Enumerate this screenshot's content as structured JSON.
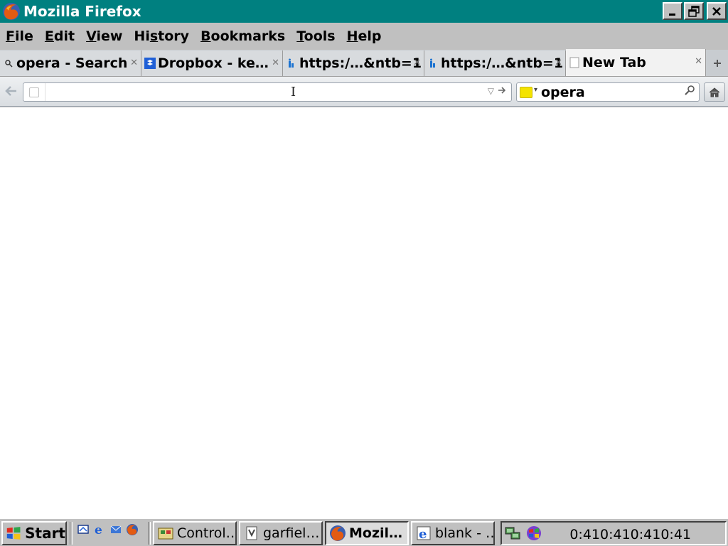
{
  "window": {
    "title": "Mozilla Firefox",
    "controls": {
      "minimize": "minimize-icon",
      "restore": "restore-icon",
      "close": "close-icon"
    }
  },
  "menu": {
    "items": [
      {
        "label": "File",
        "accel": "F",
        "rest": "ile"
      },
      {
        "label": "Edit",
        "accel": "E",
        "rest": "dit"
      },
      {
        "label": "View",
        "accel": "V",
        "rest": "iew"
      },
      {
        "label": "History",
        "pre": "Hi",
        "accel": "s",
        "rest": "tory"
      },
      {
        "label": "Bookmarks",
        "accel": "B",
        "rest": "ookmarks"
      },
      {
        "label": "Tools",
        "accel": "T",
        "rest": "ools"
      },
      {
        "label": "Help",
        "accel": "H",
        "rest": "elp"
      }
    ]
  },
  "tabs": [
    {
      "label": "opera - Search",
      "icon": "search-icon",
      "active": false
    },
    {
      "label": "Dropbox - ke…",
      "icon": "dropbox-icon",
      "active": false
    },
    {
      "label": "https:/…&ntb=1",
      "icon": "site-favicon-icon",
      "active": false
    },
    {
      "label": "https:/…&ntb=1",
      "icon": "site-favicon-icon",
      "active": false
    },
    {
      "label": "New Tab",
      "icon": "blank-page-icon",
      "active": true
    }
  ],
  "navbar": {
    "url_value": "",
    "search_value": "opera",
    "search_engine_icon": "yahoo-engine-icon"
  },
  "taskbar": {
    "start_label": "Start",
    "quick_launch": [
      "show-desktop-icon",
      "internet-explorer-icon",
      "outlook-express-icon",
      "firefox-icon"
    ],
    "tasks": [
      {
        "label": "Control…",
        "icon": "control-panel-icon",
        "active": false
      },
      {
        "label": "garfiel…",
        "icon": "file-icon",
        "active": false
      },
      {
        "label": "Mozil…",
        "icon": "firefox-icon",
        "active": true
      },
      {
        "label": "blank - …",
        "icon": "internet-explorer-icon",
        "active": false
      }
    ],
    "tray_icons": [
      "network-icon",
      "windows-flag-icon"
    ],
    "clock": "0:410:410:410:41"
  },
  "colors": {
    "titlebar": "#008080",
    "chrome": "#c0c0c0",
    "content": "#ffffff"
  }
}
